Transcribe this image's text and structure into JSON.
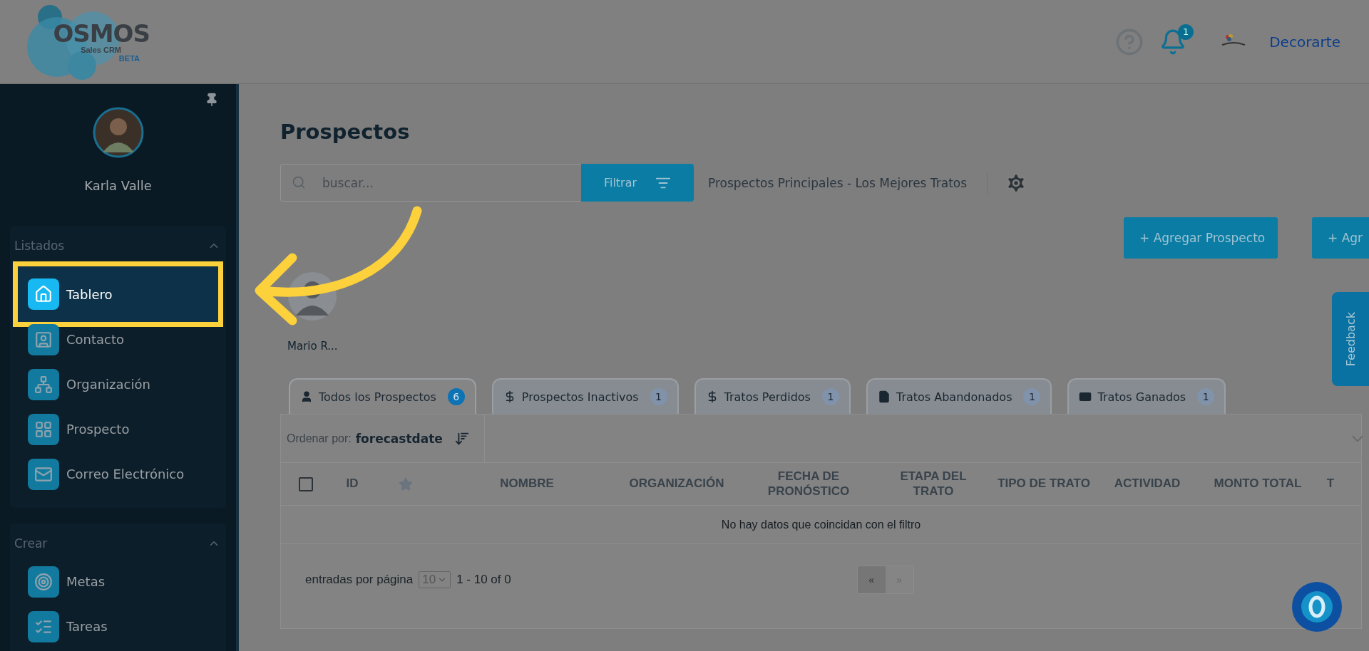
{
  "header": {
    "logo": {
      "name": "OSMOS",
      "subtitle": "Sales CRM",
      "badge": "BETA"
    },
    "notifications": {
      "count": "1"
    },
    "company": {
      "name": "Decorarte"
    }
  },
  "sidebar": {
    "user": {
      "name": "Karla Valle"
    },
    "sections": [
      {
        "title": "Listados",
        "expanded": true,
        "items": [
          {
            "label": "Tablero",
            "selected": true
          },
          {
            "label": "Contacto",
            "selected": false
          },
          {
            "label": "Organización",
            "selected": false
          },
          {
            "label": "Prospecto",
            "selected": false
          },
          {
            "label": "Correo Electrónico",
            "selected": false
          }
        ]
      },
      {
        "title": "Crear",
        "expanded": true,
        "items": [
          {
            "label": "Metas",
            "selected": false
          },
          {
            "label": "Tareas",
            "selected": false
          }
        ]
      }
    ]
  },
  "main": {
    "title": "Prospectos",
    "search": {
      "placeholder": "buscar..."
    },
    "filter_button": "Filtrar",
    "view_name": "Prospectos Principales - Los Mejores Tratos",
    "buttons": [
      "+ Agregar Prospecto",
      "+ Agr"
    ],
    "owners": [
      {
        "name": "Mario R..."
      }
    ],
    "tabs": [
      {
        "label": "Todos los Prospectos",
        "count": "6",
        "selected": true
      },
      {
        "label": "Prospectos Inactivos",
        "count": "1",
        "selected": false
      },
      {
        "label": "Tratos Perdidos",
        "count": "1",
        "selected": false
      },
      {
        "label": "Tratos Abandonados",
        "count": "1",
        "selected": false
      },
      {
        "label": "Tratos Ganados",
        "count": "1",
        "selected": false
      }
    ],
    "sort": {
      "label": "Ordenar por:",
      "value": "forecastdate"
    },
    "table": {
      "columns": [
        {
          "kind": "checkbox",
          "checked": false
        },
        {
          "kind": "text",
          "label": "ID"
        },
        {
          "kind": "star"
        },
        {
          "kind": "text",
          "label": "NOMBRE"
        },
        {
          "kind": "text",
          "label": "ORGANIZACIÓN"
        },
        {
          "kind": "text",
          "label": "FECHA DE PRONÓSTICO"
        },
        {
          "kind": "text",
          "label": "ETAPA DEL TRATO"
        },
        {
          "kind": "text",
          "label": "TIPO DE TRATO"
        },
        {
          "kind": "text",
          "label": "ACTIVIDAD"
        },
        {
          "kind": "text",
          "label": "MONTO TOTAL"
        },
        {
          "kind": "text",
          "label": "T"
        }
      ],
      "empty_message": "No hay datos que coincidan con el filtro"
    },
    "pagination": {
      "label": "entradas por página",
      "page_size": "10",
      "range": "1 - 10 of 0",
      "pages": [
        {
          "label": "«",
          "selected": true
        },
        {
          "label": "»",
          "selected": false
        }
      ]
    }
  },
  "feedback": "Feedback"
}
